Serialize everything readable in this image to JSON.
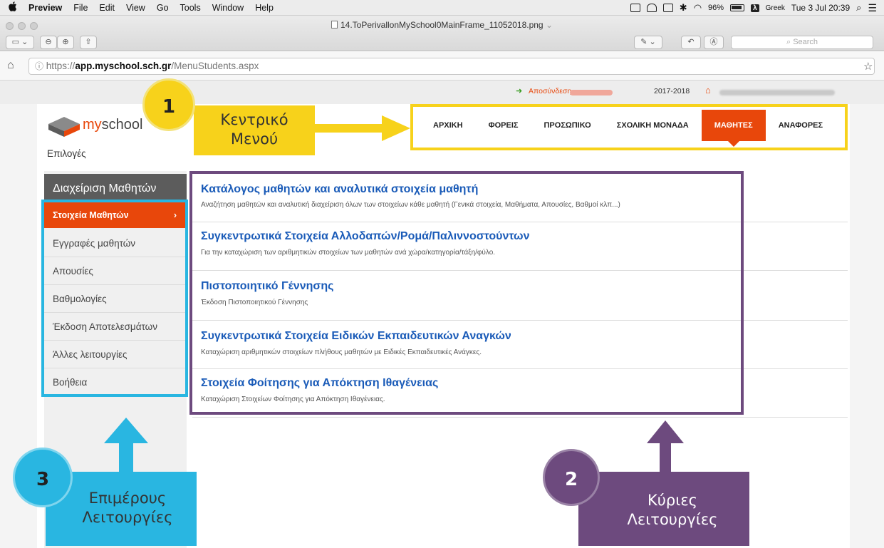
{
  "menubar": {
    "app_name": "Preview",
    "items": [
      "File",
      "Edit",
      "View",
      "Go",
      "Tools",
      "Window",
      "Help"
    ],
    "battery": "96%",
    "input_source_badge": "λ",
    "input_source": "Greek",
    "datetime": "Tue 3 Jul 20:39"
  },
  "preview": {
    "document_title": "14.ToPerivallonMySchool0MainFrame_11052018.png",
    "search_placeholder": "Search"
  },
  "browser": {
    "url_prefix": "https://",
    "url_host": "app.myschool.sch.gr",
    "url_path": "/MenuStudents.aspx"
  },
  "site": {
    "logout_label": "Αποσύνδεση",
    "school_year": "2017-2018",
    "logo_text_my": "my",
    "logo_text_school": "school",
    "nav": [
      "ΑΡΧΙΚΗ",
      "ΦΟΡΕΙΣ",
      "ΠΡΟΣΩΠΙΚΟ",
      "ΣΧΟΛΙΚΗ ΜΟΝΑΔΑ",
      "ΜΑΘΗΤΕΣ",
      "ΑΝΑΦΟΡΕΣ"
    ],
    "active_nav": "ΜΑΘΗΤΕΣ",
    "options_label": "Επιλογές",
    "sidebar_heading": "Διαχείριση Μαθητών",
    "sidebar_items": [
      "Στοιχεία Μαθητών",
      "Εγγραφές μαθητών",
      "Απουσίες",
      "Βαθμολογίες",
      "Έκδοση Αποτελεσμάτων",
      "Άλλες λειτουργίες",
      "Βοήθεια"
    ],
    "functions": [
      {
        "title": "Κατάλογος μαθητών και αναλυτικά στοιχεία μαθητή",
        "description": "Αναζήτηση μαθητών και αναλυτική διαχείριση όλων των στοιχείων κάθε μαθητή (Γενικά στοιχεία, Μαθήματα, Απουσίες, Βαθμοί κλπ...)"
      },
      {
        "title": "Συγκεντρωτικά Στοιχεία Αλλοδαπών/Ρομά/Παλιννοστούντων",
        "description": "Για την καταχώριση των αριθμητικών στοιχείων των μαθητών ανά χώρα/κατηγορία/τάξη/φύλο."
      },
      {
        "title": "Πιστοποιητικό Γέννησης",
        "description": "Έκδοση Πιστοποιητικού Γέννησης"
      },
      {
        "title": "Συγκεντρωτικά Στοιχεία Ειδικών Εκπαιδευτικών Αναγκών",
        "description": "Καταχώριση αριθμητικών στοιχείων πλήθους μαθητών με Ειδικές Εκπαιδευτικές Ανάγκες."
      },
      {
        "title": "Στοιχεία Φοίτησης για Απόκτηση Ιθαγένειας",
        "description": "Καταχώριση Στοιχείων Φοίτησης για Απόκτηση Ιθαγένειας."
      }
    ]
  },
  "annotations": {
    "one": {
      "number": "1",
      "label_line1": "Κεντρικό",
      "label_line2": "Μενού",
      "color": "#f7d21b"
    },
    "two": {
      "number": "2",
      "label_line1": "Κύριες",
      "label_line2": "Λειτουργίες",
      "color": "#6d4a7e"
    },
    "three": {
      "number": "3",
      "label_line1": "Επιμέρους",
      "label_line2": "Λειτουργίες",
      "color": "#29b6e1"
    }
  },
  "colors": {
    "accent": "#e8470b",
    "link": "#1a5bb8"
  }
}
